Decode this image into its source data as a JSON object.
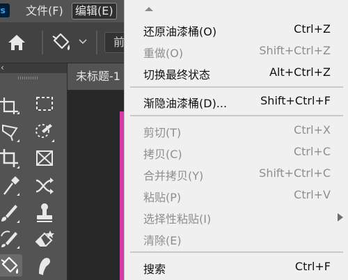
{
  "menubar": {
    "logo_text": "Ps",
    "items": [
      {
        "label": "文件(F)"
      },
      {
        "label": "编辑(E)"
      }
    ]
  },
  "options_bar": {
    "fill_select_value": "前"
  },
  "document": {
    "tab_title": "未标题-1"
  },
  "colors": {
    "menu_bg": "#f0f0f0",
    "app_bg": "#535353",
    "canvas_edge": "#d63aa8"
  },
  "edit_menu": {
    "items": [
      {
        "label": "还原油漆桶(O)",
        "shortcut": "Ctrl+Z",
        "enabled": true
      },
      {
        "label": "重做(O)",
        "shortcut": "Shift+Ctrl+Z",
        "enabled": false
      },
      {
        "label": "切换最终状态",
        "shortcut": "Alt+Ctrl+Z",
        "enabled": true
      },
      {
        "label": "渐隐油漆桶(D)...",
        "shortcut": "Shift+Ctrl+F",
        "enabled": true
      },
      {
        "label": "剪切(T)",
        "shortcut": "Ctrl+X",
        "enabled": false
      },
      {
        "label": "拷贝(C)",
        "shortcut": "Ctrl+C",
        "enabled": false
      },
      {
        "label": "合并拷贝(Y)",
        "shortcut": "Shift+Ctrl+C",
        "enabled": false
      },
      {
        "label": "粘贴(P)",
        "shortcut": "Ctrl+V",
        "enabled": false
      },
      {
        "label": "选择性粘贴(I)",
        "shortcut": "",
        "enabled": false,
        "submenu": true
      },
      {
        "label": "清除(E)",
        "shortcut": "",
        "enabled": false
      },
      {
        "label": "搜索",
        "shortcut": "Ctrl+F",
        "enabled": true
      }
    ]
  },
  "tools": [
    "artboard-tool-icon",
    "rect-marquee-tool-icon",
    "polygonal-lasso-tool-icon",
    "quick-selection-tool-icon",
    "crop-tool-icon",
    "frame-tool-icon",
    "eyedropper-tool-icon",
    "content-aware-move-tool-icon",
    "brush-tool-icon",
    "clone-stamp-tool-icon",
    "history-brush-tool-icon",
    "eraser-tool-icon",
    "paint-bucket-tool-icon",
    "smudge-tool-icon"
  ]
}
